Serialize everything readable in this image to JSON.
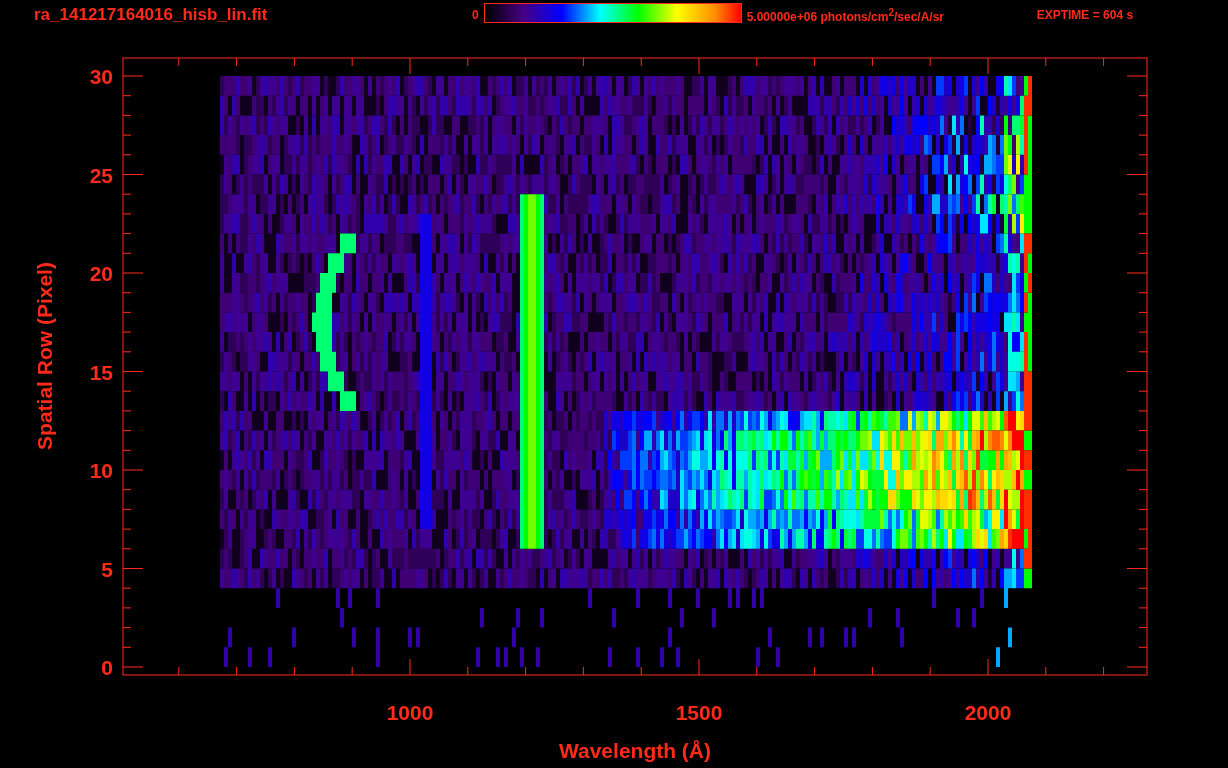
{
  "header": {
    "title": "ra_141217164016_hisb_lin.fit",
    "colorbar_min": "0",
    "colorbar_max": "5.00000e+06 photons/cm$^{2}$/sec/A/sr",
    "exptime": "EXPTIME = 604 s"
  },
  "plot": {
    "xlabel": "Wavelength (Å)",
    "ylabel": "Spatial Row (Pixel)",
    "xtick_labels": [
      "1000",
      "1500",
      "2000"
    ],
    "ytick_labels": [
      "30",
      "25",
      "20",
      "15",
      "10",
      "5",
      "0"
    ]
  }
}
